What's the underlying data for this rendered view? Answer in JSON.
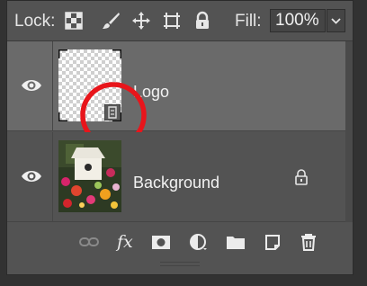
{
  "lockbar": {
    "lock_label": "Lock:",
    "lock_icons": [
      "lock-transparent-pixels-icon",
      "lock-image-pixels-icon",
      "lock-position-icon",
      "lock-artboard-icon",
      "lock-all-icon"
    ],
    "fill_label": "Fill:",
    "fill_value": "100%"
  },
  "layers": [
    {
      "name": "Logo",
      "visible": true,
      "selected": true,
      "thumbnail": "transparent-smart-object",
      "smart_object_badge": true
    },
    {
      "name": "Background",
      "visible": true,
      "selected": false,
      "thumbnail": "birdhouse-flowers-photo",
      "locked": true
    }
  ],
  "bottom_toolbar": [
    "link-layers-icon",
    "fx-icon",
    "layer-mask-icon",
    "adjustment-layer-icon",
    "new-group-icon",
    "new-layer-icon",
    "delete-layer-icon"
  ],
  "fx_label": "fx",
  "colors": {
    "panel": "#535353",
    "selected_row": "#6a6a6a",
    "annotation": "#e8151b"
  }
}
